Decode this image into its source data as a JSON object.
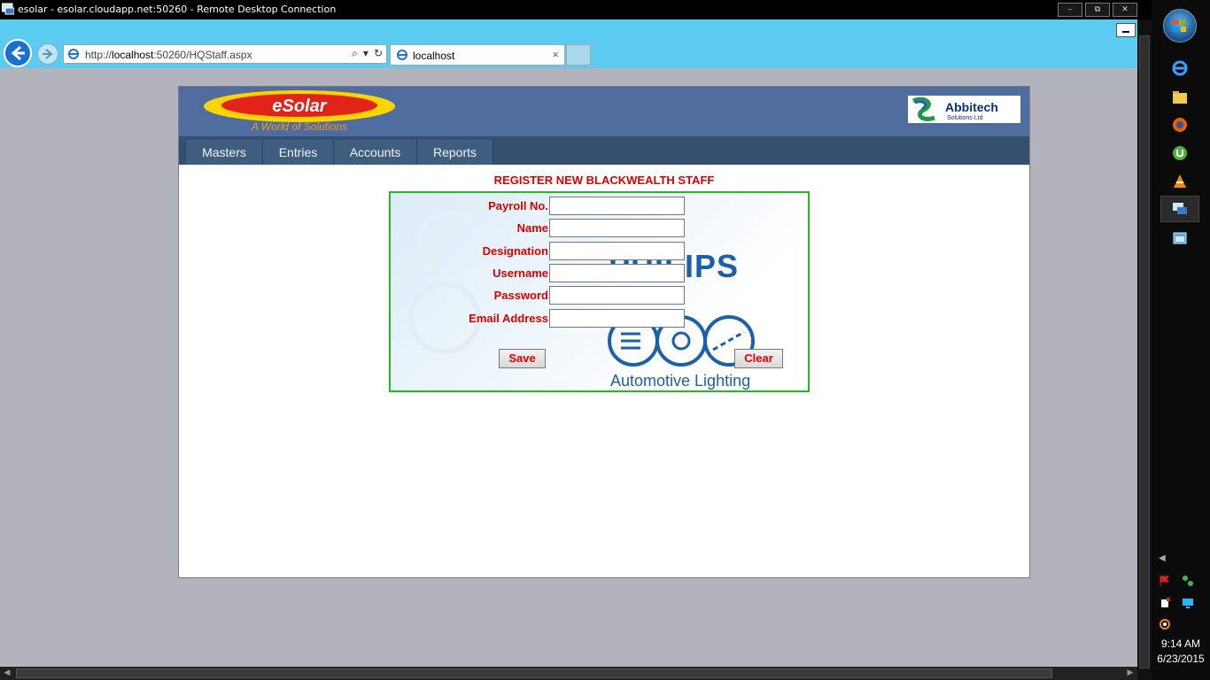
{
  "rdp": {
    "title": "esolar - esolar.cloudapp.net:50260 - Remote Desktop Connection",
    "controls": [
      "–",
      "⧉",
      "✕"
    ]
  },
  "browser": {
    "address_prefix": "http://",
    "address_host": "localhost",
    "address_rest": ":50260/HQStaff.aspx",
    "tab_label": "localhost",
    "tab_close": "×"
  },
  "header": {
    "logo_esolar_text": "eSolar",
    "logo_esolar_tagline": "A World of Solutions",
    "logo_abbitech_text": "Abbitech",
    "logo_abbitech_sub": "Solutions Ltd"
  },
  "nav": {
    "items": [
      {
        "label": "Masters"
      },
      {
        "label": "Entries"
      },
      {
        "label": "Accounts"
      },
      {
        "label": "Reports"
      }
    ]
  },
  "form": {
    "title": "REGISTER NEW BLACKWEALTH STAFF",
    "fields": [
      {
        "label": "Payroll No.",
        "value": ""
      },
      {
        "label": "Name",
        "value": ""
      },
      {
        "label": "Designation",
        "value": ""
      },
      {
        "label": "Username",
        "value": ""
      },
      {
        "label": "Password",
        "value": ""
      },
      {
        "label": "Email Address",
        "value": ""
      }
    ],
    "save_label": "Save",
    "clear_label": "Clear",
    "background_brand": "PHILIPS",
    "background_caption": "Automotive Lighting"
  },
  "taskbar": {
    "time": "9:14 AM",
    "date": "6/23/2015",
    "apps": [
      "internet-explorer-icon",
      "file-explorer-icon",
      "firefox-icon",
      "utorrent-icon",
      "vlc-icon",
      "remote-desktop-icon",
      "window-manager-icon"
    ]
  },
  "colors": {
    "accent_red": "#dd0000",
    "header_blue": "#4e6c9d",
    "nav_blue": "#34506e",
    "form_border": "#22bb22",
    "ie_chrome": "#5bcbef"
  }
}
